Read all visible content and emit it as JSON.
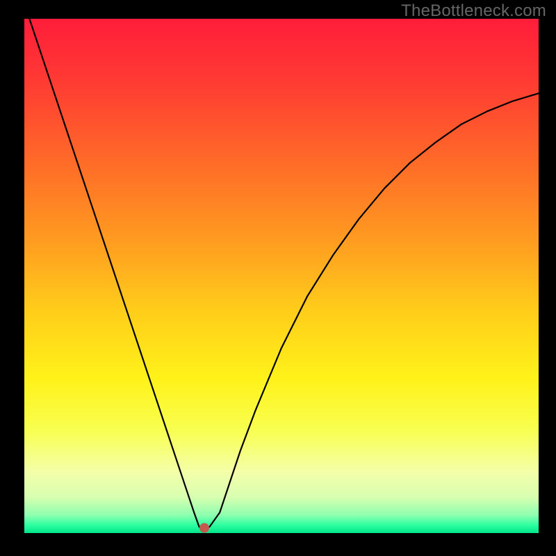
{
  "watermark": "TheBottleneck.com",
  "chart_data": {
    "type": "line",
    "title": "",
    "xlabel": "",
    "ylabel": "",
    "xlim": [
      0,
      100
    ],
    "ylim": [
      0,
      100
    ],
    "grid": false,
    "legend": false,
    "series": [
      {
        "name": "curve",
        "x": [
          1,
          5,
          10,
          15,
          20,
          25,
          28,
          30,
          32,
          33,
          34,
          35,
          36,
          38,
          40,
          42,
          45,
          50,
          55,
          60,
          65,
          70,
          75,
          80,
          85,
          90,
          95,
          100
        ],
        "y": [
          100,
          88,
          73,
          58,
          43,
          28,
          19,
          13,
          7,
          4,
          1.2,
          1.0,
          1.2,
          4,
          10,
          16,
          24,
          36,
          46,
          54,
          61,
          67,
          72,
          76,
          79.5,
          82,
          84,
          85.5
        ]
      }
    ],
    "marker": {
      "name": "optimal-point",
      "x": 35,
      "y": 1.0,
      "color": "#c35a4e",
      "radius_px": 7
    },
    "background_gradient": {
      "stops": [
        {
          "offset": 0.0,
          "color": "#ff1d3a"
        },
        {
          "offset": 0.12,
          "color": "#ff3a33"
        },
        {
          "offset": 0.28,
          "color": "#ff6b28"
        },
        {
          "offset": 0.43,
          "color": "#ff9b20"
        },
        {
          "offset": 0.57,
          "color": "#ffce1a"
        },
        {
          "offset": 0.7,
          "color": "#fff21a"
        },
        {
          "offset": 0.8,
          "color": "#f8ff50"
        },
        {
          "offset": 0.88,
          "color": "#f4ffa8"
        },
        {
          "offset": 0.93,
          "color": "#d8ffb0"
        },
        {
          "offset": 0.965,
          "color": "#8fffb0"
        },
        {
          "offset": 0.985,
          "color": "#2bffa0"
        },
        {
          "offset": 1.0,
          "color": "#00e48a"
        }
      ]
    }
  }
}
